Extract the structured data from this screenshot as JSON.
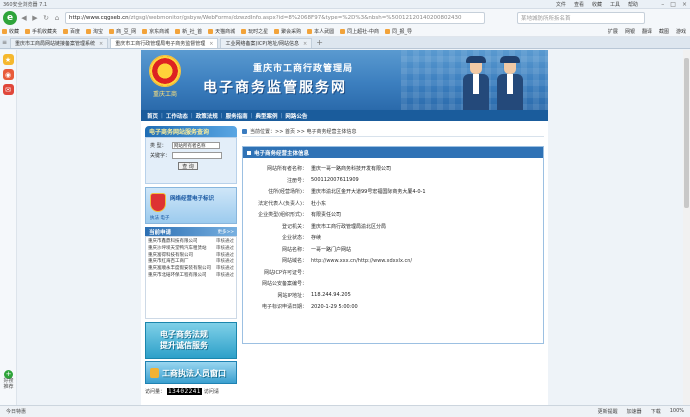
{
  "browser": {
    "title": "360安全浏览器 7.1",
    "menus": [
      "文件",
      "查看",
      "收藏",
      "工具",
      "帮助"
    ],
    "logo": "e",
    "address": {
      "host": "http://www.cqgseb.cn",
      "rest": "/ztgsgl/webmonitor/gsbyw/WebForms/dzwzdInfo.aspx?id=8%2068F97&type=%2D%3&nbsh=%50012120140200802430"
    },
    "search_placeholder": "某地城防所所拆名首",
    "favorites": [
      "收藏",
      "手机收藏夹",
      "百度",
      "淘宝",
      "商_豆_网",
      "京东商城",
      "新_社_首",
      "天猫商城",
      "玩时之星",
      "聚会采购",
      "本人武圆",
      "同上超社-中商",
      "同_报_导"
    ],
    "fav_right": [
      "扩展",
      "网银",
      "翻译",
      "截图",
      "游戏"
    ],
    "tabs": [
      {
        "label": "重庆市工商局网站链接备案管理系统",
        "active": false
      },
      {
        "label": "重庆市工商行政管理局电子商务监督管理",
        "active": true
      },
      {
        "label": "工业网络备案(ICP)地址/网站信息",
        "active": false
      }
    ],
    "status_left": "今日特惠",
    "status_right": [
      "更新提醒",
      "加速器",
      "下载",
      "100%"
    ]
  },
  "sidebar": {
    "bottom_label": "好搜推荐",
    "plus": "+"
  },
  "banner": {
    "line1": "重庆市工商行政管理局",
    "line2": "电子商务监管服务网",
    "emblem_label": "重庆工商"
  },
  "menu": [
    "首页",
    "工作动态",
    "政策法规",
    "服务指南",
    "典型案例",
    "网路公告"
  ],
  "search_panel": {
    "title": "电子商务网站服务查询",
    "type_label": "类 型：",
    "type_value": "网站所有者名称",
    "keyword_label": "关键字：",
    "button": "查 询"
  },
  "badge_banner": {
    "title": "网络经营电子标识",
    "subtitle": "执法 电子"
  },
  "list": {
    "title": "当前申请",
    "more": "更多>>",
    "items": [
      {
        "name": "重庆市鑫鼎科技有限公司",
        "status": "审核通过"
      },
      {
        "name": "重庆沙坪坝天堂鸭汽车租赁站",
        "status": "审核通过"
      },
      {
        "name": "重庆富得科技有限公司",
        "status": "审核通过"
      },
      {
        "name": "重庆市红海百工商厂",
        "status": "审核通过"
      },
      {
        "name": "重庆富顺永丰度假安装有限公司",
        "status": "审核通过"
      },
      {
        "name": "重庆市北碚环保工程有限公司",
        "status": "审核通过"
      }
    ]
  },
  "promo1": {
    "line1": "电子商务法规",
    "line2": "提升诚信服务"
  },
  "promo2": {
    "text": "工商执法人员窗口"
  },
  "counter": {
    "label": "访问量：",
    "digits": "13402241",
    "suffix": "访问请"
  },
  "breadcrumb": "当前位置：>> 首页 >> 电子商务经营主体信息",
  "detail": {
    "title": "电子商务经营主体信息",
    "rows": [
      {
        "k": "网站所有者名称：",
        "v": "重庆一哥一路商务科技开发有限公司"
      },
      {
        "k": "注册号：",
        "v": "500112007611909"
      },
      {
        "k": "住所(经营场所)：",
        "v": "重庆市渝北区金开大道99号宏福国际商务大厦4-0-1"
      },
      {
        "k": "法定代表人(负责人)：",
        "v": "杜小东"
      },
      {
        "k": "企业类型(组织形式)：",
        "v": "有限责任公司"
      },
      {
        "k": "登记机关：",
        "v": "重庆市工商行政管理局渝北区分局"
      },
      {
        "k": "企业状态：",
        "v": "存续"
      },
      {
        "k": "网站名称：",
        "v": "一哥一路门户网站"
      },
      {
        "k": "网站域名：",
        "v": "http://www.xxx.cn/http://www.xdxxlx.cn/"
      },
      {
        "k": "网站ICP许可证号：",
        "v": ""
      },
      {
        "k": "网站公安备案编号：",
        "v": ""
      },
      {
        "k": "网站IP地址：",
        "v": "118.244.94.205"
      },
      {
        "k": "电子标识申请日期：",
        "v": "2020-1-29 5:00:00"
      }
    ]
  },
  "colors": {
    "banner": "#3c7fbf",
    "menubar": "#1a5c9c",
    "detail_head": "#2f72b5",
    "accent_green": "#2ea43a"
  }
}
